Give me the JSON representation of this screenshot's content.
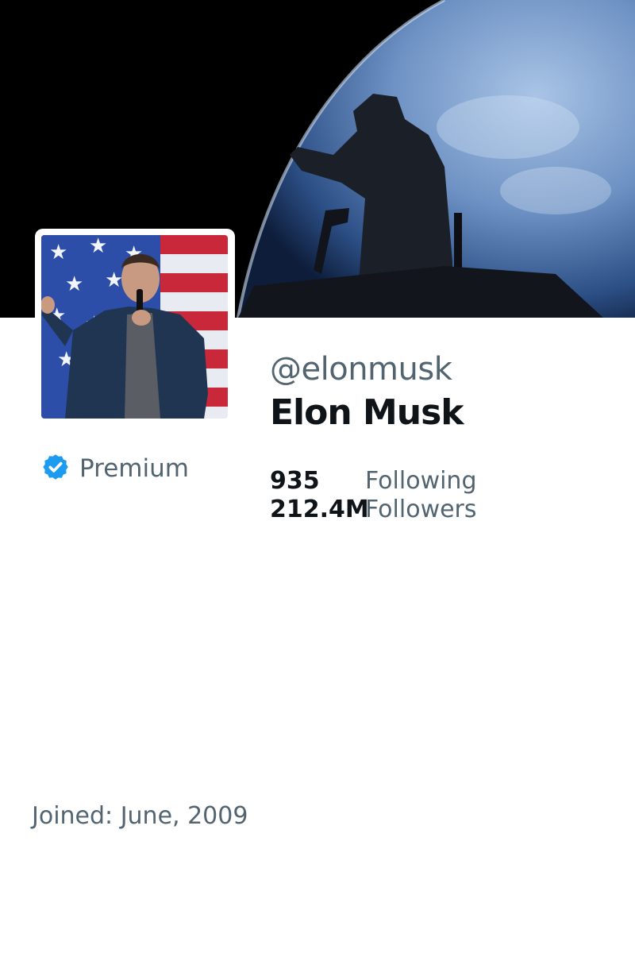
{
  "profile": {
    "handle": "@elonmusk",
    "display_name": "Elon Musk",
    "badge": {
      "icon": "verified-badge-icon",
      "label": "Premium",
      "color": "#1d9bf0"
    },
    "stats": {
      "following": {
        "count": "935",
        "label": "Following"
      },
      "followers": {
        "count": "212.4M",
        "label": "Followers"
      }
    },
    "joined": "Joined: June, 2009"
  },
  "colors": {
    "text_primary": "#0f1419",
    "text_secondary": "#536471",
    "accent": "#1d9bf0"
  }
}
